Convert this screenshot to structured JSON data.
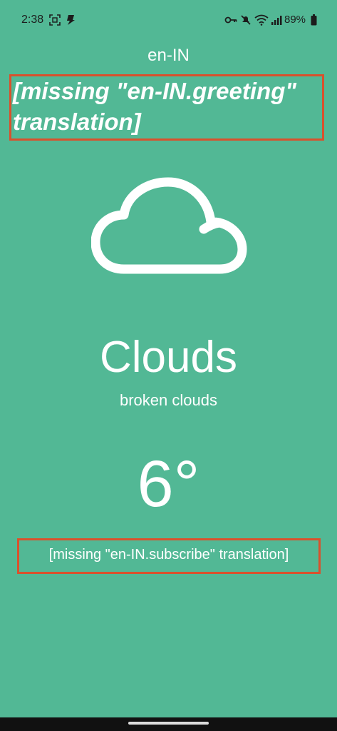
{
  "status_bar": {
    "time": "2:38",
    "battery": "89%",
    "icons": [
      "screenshot-icon",
      "app-notification-icon",
      "key-icon",
      "mute-icon",
      "wifi-icon",
      "signal-icon",
      "battery-icon"
    ]
  },
  "main": {
    "locale": "en-IN",
    "greeting": "[missing \"en-IN.greeting\" translation]",
    "weather_icon": "cloud-icon",
    "condition": "Clouds",
    "description": "broken clouds",
    "temperature": "6°",
    "subscribe": "[missing \"en-IN.subscribe\" translation]"
  },
  "colors": {
    "background": "#52b895",
    "highlight_border": "#d9512c",
    "text": "#ffffff"
  }
}
